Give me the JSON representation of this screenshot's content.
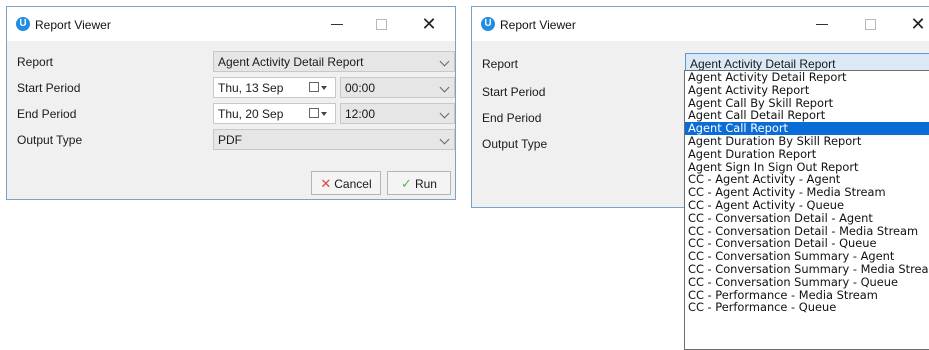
{
  "left_window": {
    "title": "Report Viewer",
    "app_icon": "U",
    "controls": {
      "minimize": "minimize-icon",
      "maximize": "maximize-icon",
      "close": "✕"
    },
    "fields": {
      "report_label": "Report",
      "report_value": "Agent Activity Detail Report",
      "start_label": "Start Period",
      "start_date": "Thu, 13 Sep",
      "start_time": "00:00",
      "end_label": "End Period",
      "end_date": "Thu, 20 Sep",
      "end_time": "12:00",
      "output_label": "Output Type",
      "output_value": "PDF"
    },
    "buttons": {
      "cancel": "Cancel",
      "cancel_icon": "✕",
      "run": "Run",
      "run_icon": "✓"
    }
  },
  "right_window": {
    "title": "Report Viewer",
    "app_icon": "U",
    "controls": {
      "minimize": "minimize-icon",
      "maximize": "maximize-icon",
      "close": "✕"
    },
    "fields": {
      "report_label": "Report",
      "report_value": "Agent Activity Detail Report",
      "start_label": "Start Period",
      "end_label": "End Period",
      "output_label": "Output Type"
    },
    "dropdown": {
      "selected_index": 4,
      "options": [
        "Agent Activity Detail Report",
        "Agent Activity Report",
        "Agent Call By Skill Report",
        "Agent Call Detail Report",
        "Agent Call Report",
        "Agent Duration By Skill Report",
        "Agent Duration Report",
        "Agent Sign In Sign Out Report",
        "CC - Agent Activity - Agent",
        "CC - Agent Activity - Media Stream",
        "CC - Agent Activity - Queue",
        "CC - Conversation Detail - Agent",
        "CC - Conversation Detail - Media Stream",
        "CC - Conversation Detail - Queue",
        "CC - Conversation Summary - Agent",
        "CC - Conversation Summary - Media Stream",
        "CC - Conversation Summary - Queue",
        "CC - Performance - Media Stream",
        "CC - Performance - Queue"
      ]
    }
  },
  "colors": {
    "accent": "#1f8de1",
    "selection": "#0a6cd6",
    "cancel_icon": "#e0463a",
    "run_icon": "#5bb55b"
  }
}
